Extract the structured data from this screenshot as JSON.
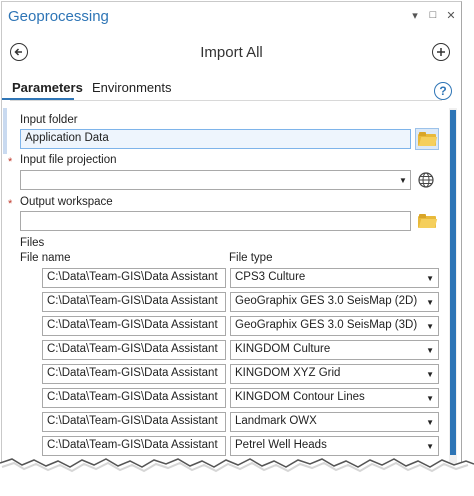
{
  "window": {
    "title": "Geoprocessing",
    "controls": {
      "menu": "▾",
      "restore": "□",
      "close": "✕"
    }
  },
  "tool": {
    "back_icon": "back-arrow-icon",
    "title": "Import All",
    "add_icon": "plus-icon"
  },
  "tabs": [
    {
      "label": "Parameters",
      "active": true
    },
    {
      "label": "Environments",
      "active": false
    }
  ],
  "help_icon": "?",
  "parameters": {
    "input_folder": {
      "label": "Input folder",
      "value": "Application Data",
      "required": false
    },
    "input_projection": {
      "label": "Input file projection",
      "value": "",
      "required": true,
      "required_mark": "*"
    },
    "output_workspace": {
      "label": "Output workspace",
      "value": "",
      "required": true,
      "required_mark": "*"
    }
  },
  "files": {
    "label": "Files",
    "columns": {
      "name": "File name",
      "type": "File type"
    },
    "rows": [
      {
        "name": "C:\\Data\\Team-GIS\\Data Assistant",
        "type": "CPS3 Culture"
      },
      {
        "name": "C:\\Data\\Team-GIS\\Data Assistant",
        "type": "GeoGraphix GES 3.0 SeisMap (2D)"
      },
      {
        "name": "C:\\Data\\Team-GIS\\Data Assistant",
        "type": "GeoGraphix GES 3.0 SeisMap (3D)"
      },
      {
        "name": "C:\\Data\\Team-GIS\\Data Assistant",
        "type": "KINGDOM Culture"
      },
      {
        "name": "C:\\Data\\Team-GIS\\Data Assistant",
        "type": "KINGDOM XYZ Grid"
      },
      {
        "name": "C:\\Data\\Team-GIS\\Data Assistant",
        "type": "KINGDOM Contour Lines"
      },
      {
        "name": "C:\\Data\\Team-GIS\\Data Assistant",
        "type": "Landmark OWX"
      },
      {
        "name": "C:\\Data\\Team-GIS\\Data Assistant",
        "type": "Petrel Well Heads"
      }
    ]
  },
  "colors": {
    "accent": "#2e75b6",
    "required": "#c0392b",
    "folder": "#e8b93a"
  }
}
